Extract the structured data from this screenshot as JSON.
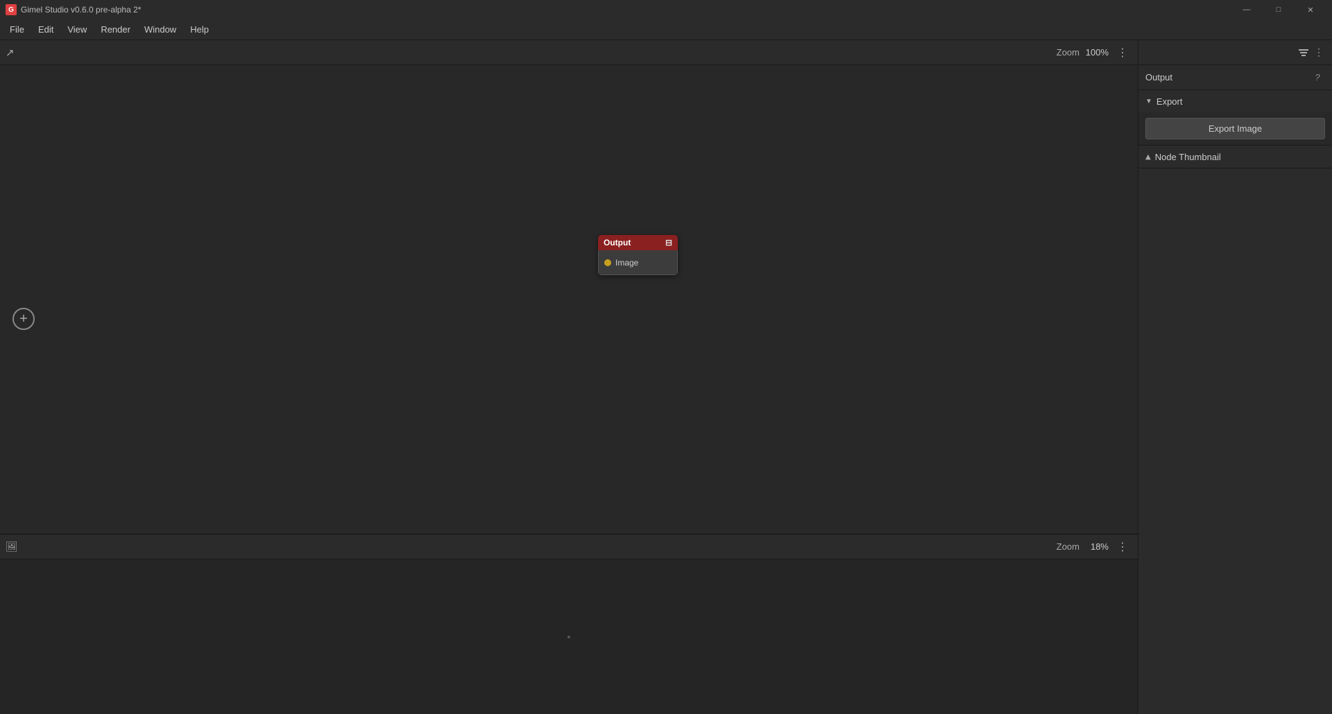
{
  "titlebar": {
    "app_icon": "G",
    "title": "Gimel Studio v0.6.0 pre-alpha 2*",
    "minimize": "—",
    "maximize": "□",
    "close": "✕"
  },
  "menubar": {
    "items": [
      "File",
      "Edit",
      "View",
      "Render",
      "Window",
      "Help"
    ]
  },
  "node_toolbar": {
    "zoom_label": "Zoom",
    "zoom_value": "100%",
    "more_icon": "⋮",
    "share_icon": "↗"
  },
  "node_canvas": {
    "output_node": {
      "title": "Output",
      "port_label": "Image"
    },
    "add_button": "+"
  },
  "image_viewer_toolbar": {
    "zoom_label": "Zoom",
    "zoom_value": "18%",
    "more_icon": "⋮",
    "image_icon": "🖼"
  },
  "right_panel": {
    "title": "Output",
    "help_icon": "?",
    "filter_icon": "☰",
    "sections": [
      {
        "label": "Export",
        "expanded": true,
        "chevron": "▼",
        "content": {
          "export_button": "Export Image"
        }
      },
      {
        "label": "Node Thumbnail",
        "expanded": false,
        "chevron": "▶"
      }
    ]
  }
}
